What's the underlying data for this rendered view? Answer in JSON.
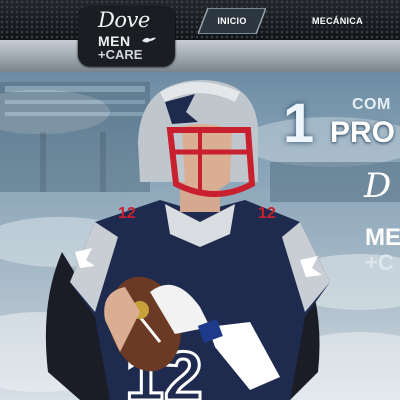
{
  "brand": {
    "logo_top": "Dove",
    "logo_middle": "MEN",
    "logo_bottom": "+CARE"
  },
  "nav": {
    "items": [
      {
        "label": "INICIO",
        "active": true
      },
      {
        "label": "MECÁNICA",
        "active": false
      }
    ]
  },
  "hero": {
    "promo_number": "1",
    "promo_line1": "COM",
    "promo_line2": "PRO",
    "promo_brand_top": "D",
    "promo_brand_middle": "ME",
    "promo_brand_bottom": "+C"
  },
  "colors": {
    "nav_bg": "#1b1f24",
    "nav_active": "#7f8b96",
    "jersey": "#1d2a4c",
    "helmet": "#c9ced3",
    "facemask": "#c8202f",
    "sky": "#86a2b6"
  }
}
